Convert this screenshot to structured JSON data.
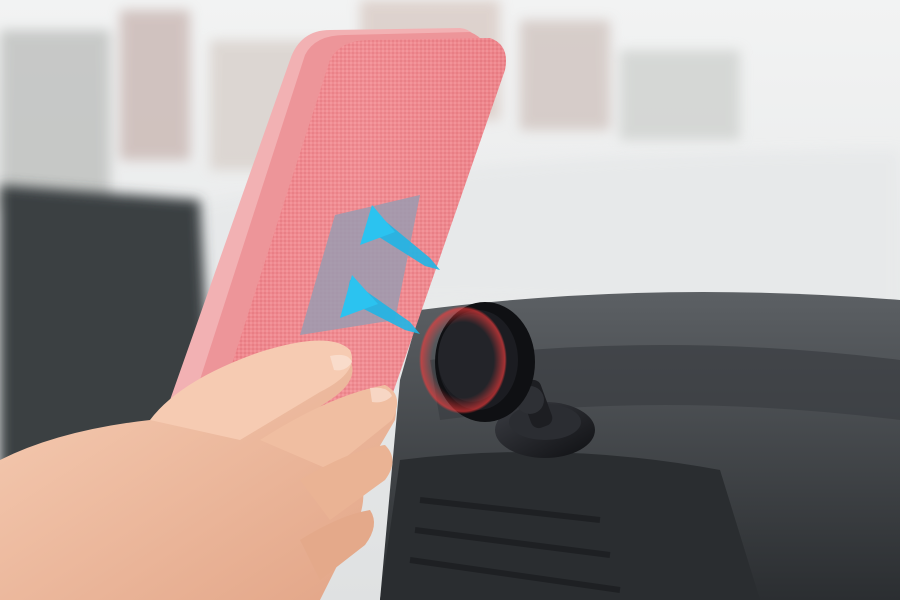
{
  "scene": {
    "subject": "hand-holding-phone-case-to-magnetic-car-mount",
    "colors": {
      "sky": "#eceeee",
      "windshield_haze": "#e3e5e6",
      "street_buildings": "#d6d0cc",
      "dashboard": "#4a4e52",
      "dashboard_shadow": "#2a2d30",
      "case_pink": "#f08a8f",
      "case_edge": "#f4b8b8",
      "fabric_texture": "#e47a80",
      "metal_plate": "#9a9bb0",
      "arrow_cyan": "#1fb5e6",
      "mount_black": "#1a1b1f",
      "skin": "#f2c2a6",
      "skin_shadow": "#e2a486"
    },
    "icons": [
      "arrow-icon",
      "arrow-icon"
    ]
  }
}
